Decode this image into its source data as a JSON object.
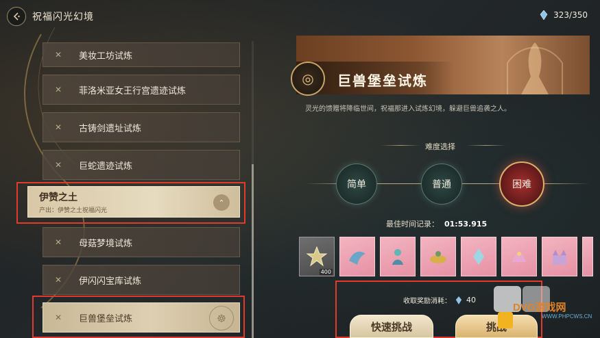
{
  "header": {
    "title": "祝福闪光幻境",
    "stamina": "323/350"
  },
  "trial_list": {
    "items": [
      {
        "label": "美妆工坊试炼"
      },
      {
        "label": "菲洛米亚女王行宫遗迹试炼"
      },
      {
        "label": "古铸剑遗址试炼"
      },
      {
        "label": "巨蛇遗迹试炼"
      },
      {
        "label": "母菇梦境试炼"
      },
      {
        "label": "伊闪闪宝库试炼"
      },
      {
        "label": "巨兽堡垒试炼"
      }
    ],
    "region": {
      "name": "伊赞之土",
      "source": "产出：伊赞之土祝福闪光"
    }
  },
  "detail": {
    "title": "巨兽堡垒试炼",
    "description": "灵光的馈赠将降临世间，祝福那进入试炼幻境，躲避巨兽追袭之人。",
    "difficulty_title": "难度选择",
    "difficulties": [
      "简单",
      "普通",
      "困难"
    ],
    "selected_difficulty": "困难",
    "best_time_label": "最佳时间记录：",
    "best_time_value": "01:53.915",
    "reward_first_count": "400",
    "cost_label": "收取奖励消耗：",
    "cost_value": "40",
    "quick_challenge_label": "快速挑战",
    "challenge_label": "挑战"
  },
  "watermark": {
    "text": "DVG游戏网",
    "url": "WWW.PHPCWS.CN"
  },
  "colors": {
    "highlight_box": "#e23a2c",
    "hard_difficulty": "#a4302e"
  }
}
